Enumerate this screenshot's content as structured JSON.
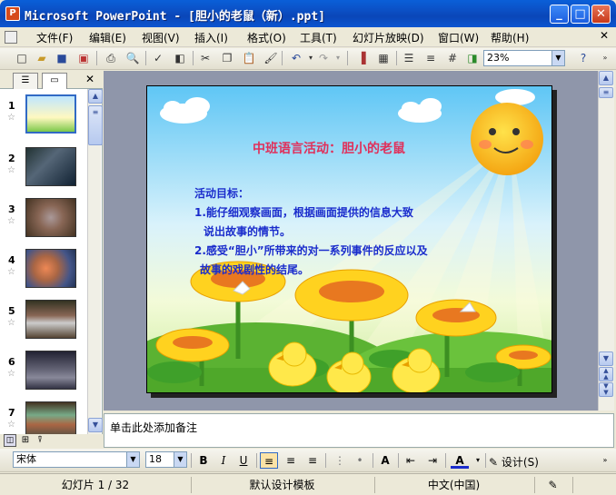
{
  "window": {
    "title": "Microsoft PowerPoint - [胆小的老鼠（新）.ppt]",
    "app_icon": "powerpoint-icon"
  },
  "menu": [
    "文件(F)",
    "编辑(E)",
    "视图(V)",
    "插入(I)",
    "格式(O)",
    "工具(T)",
    "幻灯片放映(D)",
    "窗口(W)",
    "帮助(H)"
  ],
  "toolbar": {
    "zoom": "23%"
  },
  "format_toolbar": {
    "font": "宋体",
    "size": "18",
    "bold": "B",
    "italic": "I",
    "underline": "U",
    "design": "设计(S)"
  },
  "thumbnails": [
    "1",
    "2",
    "3",
    "4",
    "5",
    "6",
    "7"
  ],
  "slide": {
    "title": "中班语言活动：胆小的老鼠",
    "lines": [
      "活动目标：",
      "1.能仔细观察画面，根据画面提供的信息大致",
      "说出故事的情节。",
      "2.感受“胆小”所带来的对一系列事件的反应以及",
      "故事的戏剧性的结尾。"
    ]
  },
  "notes": {
    "placeholder": "单击此处添加备注"
  },
  "status": {
    "slide": "幻灯片 1 / 32",
    "template": "默认设计模板",
    "language": "中文(中国)"
  },
  "colors": {
    "title_bar": "#0a5fd8",
    "slide_title": "#e0305a",
    "slide_body": "#1a2ccc"
  }
}
